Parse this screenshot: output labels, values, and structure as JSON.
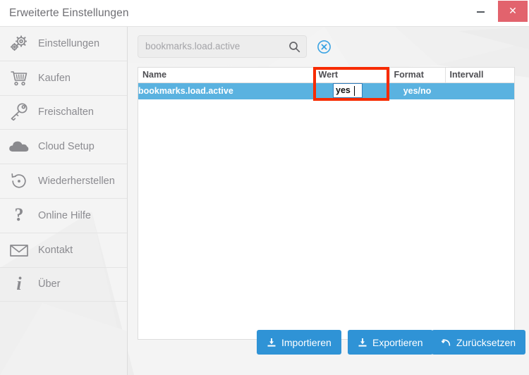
{
  "window": {
    "title": "Erweiterte Einstellungen",
    "minimize_label": "–",
    "close_label": "✕",
    "close_color": "#e2636d"
  },
  "sidebar": {
    "items": [
      {
        "label": "Einstellungen",
        "icon": "gears-icon"
      },
      {
        "label": "Kaufen",
        "icon": "shopping-cart-icon"
      },
      {
        "label": "Freischalten",
        "icon": "key-icon"
      },
      {
        "label": "Cloud Setup",
        "icon": "cloud-icon"
      },
      {
        "label": "Wiederherstellen",
        "icon": "restore-icon"
      },
      {
        "label": "Online Hilfe",
        "icon": "question-mark-icon"
      },
      {
        "label": "Kontakt",
        "icon": "envelope-icon"
      },
      {
        "label": "Über",
        "icon": "info-icon"
      }
    ]
  },
  "search": {
    "value": "",
    "placeholder": "bookmarks.load.active",
    "icon": "search-icon",
    "clear_icon": "clear-circle-icon",
    "clear_color": "#3aa3e3"
  },
  "table": {
    "columns": [
      "Name",
      "Wert",
      "Format",
      "Intervall"
    ],
    "rows": [
      {
        "name": "bookmarks.load.active",
        "wert": "yes",
        "format": "yes/no",
        "intervall": "",
        "selected": true
      }
    ],
    "selection_color": "#5ab2e0",
    "annotation_color": "#f72b00",
    "editing": {
      "column": "Wert",
      "value": "yes"
    }
  },
  "footer": {
    "buttons": [
      {
        "label": "Importieren",
        "icon": "import-download-icon"
      },
      {
        "label": "Exportieren",
        "icon": "export-download-icon"
      },
      {
        "label": "Zurücksetzen",
        "icon": "undo-arrow-icon"
      }
    ],
    "button_color": "#2f93d6"
  }
}
